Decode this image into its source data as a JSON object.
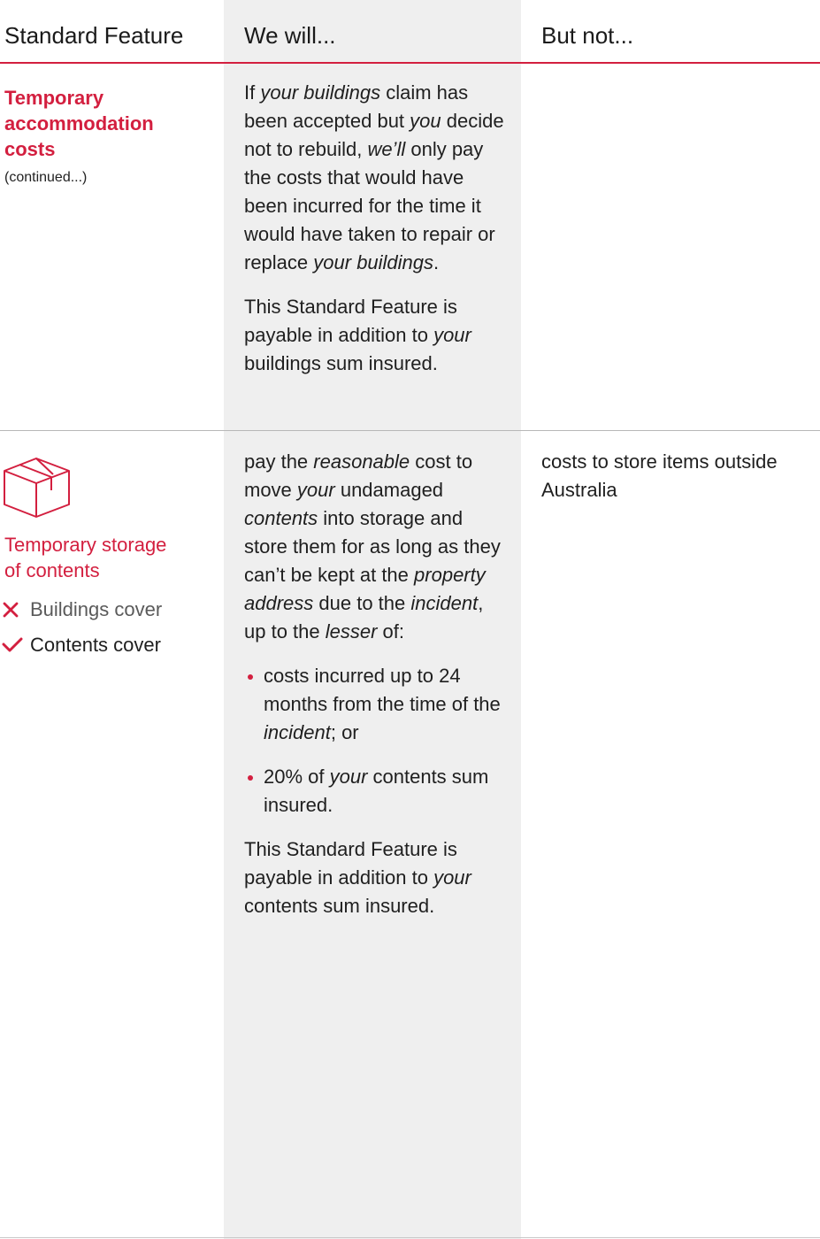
{
  "header": {
    "col1": "Standard Feature",
    "col2": "We will...",
    "col3": "But not..."
  },
  "row1": {
    "title_lines": [
      "Temporary",
      "accommodation",
      "costs"
    ],
    "continued": "(continued...)",
    "will": {
      "para1": [
        [
          "If ",
          ""
        ],
        [
          "your buildings",
          "i"
        ],
        [
          " claim has been accepted but ",
          ""
        ],
        [
          "you",
          "i"
        ],
        [
          " decide not to rebuild, ",
          ""
        ],
        [
          "we’ll",
          "i"
        ],
        [
          " only pay the costs that would have been incurred for the time it would have taken to repair or replace ",
          ""
        ],
        [
          "your buildings",
          "i"
        ],
        [
          ".",
          ""
        ]
      ],
      "para2": [
        [
          "This Standard Feature is payable in addition to ",
          ""
        ],
        [
          "your",
          "i"
        ],
        [
          " buildings sum insured.",
          ""
        ]
      ]
    }
  },
  "row2": {
    "icon": "box-icon",
    "title_lines": [
      "Temporary storage",
      "of contents"
    ],
    "covers": [
      {
        "label": "Buildings cover",
        "included": false,
        "icon": "cross-icon"
      },
      {
        "label": "Contents cover",
        "included": true,
        "icon": "check-icon"
      }
    ],
    "will": {
      "intro": [
        [
          "pay the ",
          ""
        ],
        [
          "reasonable",
          "i"
        ],
        [
          " cost to move ",
          ""
        ],
        [
          "your",
          "i"
        ],
        [
          " undamaged ",
          ""
        ],
        [
          "contents",
          "i"
        ],
        [
          " into storage and store them for as long as they can’t be kept at the ",
          ""
        ],
        [
          "property address",
          "i"
        ],
        [
          " due to the ",
          ""
        ],
        [
          "incident",
          "i"
        ],
        [
          ", up to the ",
          ""
        ],
        [
          "lesser",
          "i"
        ],
        [
          " of:",
          ""
        ]
      ],
      "bullets": [
        [
          [
            "costs incurred up to 24 months from the time of the ",
            ""
          ],
          [
            "incident",
            "i"
          ],
          [
            "; or",
            ""
          ]
        ],
        [
          [
            "20% of ",
            ""
          ],
          [
            "your",
            "i"
          ],
          [
            " contents sum insured.",
            ""
          ]
        ]
      ],
      "closing": [
        [
          "This Standard Feature is payable in addition to ",
          ""
        ],
        [
          "your",
          "i"
        ],
        [
          " contents sum insured.",
          ""
        ]
      ]
    },
    "not": "costs to store items outside Australia"
  },
  "colors": {
    "accent": "#d31f3f",
    "shaded_column": "#efefef",
    "rule": "#b8b8b8",
    "text": "#1f1f1f"
  }
}
